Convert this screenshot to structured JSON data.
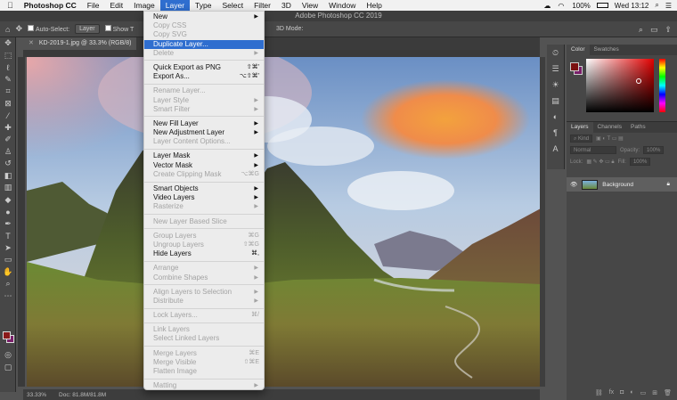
{
  "menubar": {
    "items": [
      {
        "label": "Photoshop CC",
        "bold": true
      },
      {
        "label": "File"
      },
      {
        "label": "Edit"
      },
      {
        "label": "Image"
      },
      {
        "label": "Layer",
        "active": true
      },
      {
        "label": "Type"
      },
      {
        "label": "Select"
      },
      {
        "label": "Filter"
      },
      {
        "label": "3D"
      },
      {
        "label": "View"
      },
      {
        "label": "Window"
      },
      {
        "label": "Help"
      }
    ],
    "battery": "100%",
    "clock": "Wed 13:12"
  },
  "window": {
    "title": "Adobe Photoshop CC 2019"
  },
  "options_bar": {
    "auto_select_label": "Auto-Select:",
    "auto_select_value": "Layer",
    "show_transform": "Show T",
    "three_d_mode": "3D Mode:"
  },
  "document": {
    "tab_label": "KD-2019-1.jpg @ 33.3% (RGB/8)",
    "zoom": "33.33%",
    "doc_size": "Doc: 81.8M/81.8M"
  },
  "panels": {
    "color_tabs": [
      "Color",
      "Swatches"
    ],
    "layer_tabs": [
      "Layers",
      "Channels",
      "Paths"
    ],
    "kind_label": "Kind",
    "blend_mode": "Normal",
    "opacity_label": "Opacity:",
    "opacity_value": "100%",
    "lock_label": "Lock:",
    "fill_label": "Fill:",
    "fill_value": "100%",
    "layers": [
      {
        "name": "Background"
      }
    ],
    "colors": {
      "foreground": "#7a1010",
      "background": "#7a1f6a"
    }
  },
  "layer_menu": {
    "sections": [
      [
        {
          "label": "New",
          "submenu": true
        },
        {
          "label": "Copy CSS",
          "disabled": true
        },
        {
          "label": "Copy SVG",
          "disabled": true
        },
        {
          "label": "Duplicate Layer...",
          "highlighted": true
        },
        {
          "label": "Delete",
          "disabled": true,
          "submenu": true
        }
      ],
      [
        {
          "label": "Quick Export as PNG",
          "shortcut": "⇧⌘'"
        },
        {
          "label": "Export As...",
          "shortcut": "⌥⇧⌘'"
        }
      ],
      [
        {
          "label": "Rename Layer...",
          "disabled": true
        },
        {
          "label": "Layer Style",
          "disabled": true,
          "submenu": true
        },
        {
          "label": "Smart Filter",
          "disabled": true,
          "submenu": true
        }
      ],
      [
        {
          "label": "New Fill Layer",
          "submenu": true
        },
        {
          "label": "New Adjustment Layer",
          "submenu": true
        },
        {
          "label": "Layer Content Options...",
          "disabled": true
        }
      ],
      [
        {
          "label": "Layer Mask",
          "submenu": true
        },
        {
          "label": "Vector Mask",
          "submenu": true
        },
        {
          "label": "Create Clipping Mask",
          "disabled": true,
          "shortcut": "⌥⌘G"
        }
      ],
      [
        {
          "label": "Smart Objects",
          "submenu": true
        },
        {
          "label": "Video Layers",
          "submenu": true
        },
        {
          "label": "Rasterize",
          "disabled": true,
          "submenu": true
        }
      ],
      [
        {
          "label": "New Layer Based Slice",
          "disabled": true
        }
      ],
      [
        {
          "label": "Group Layers",
          "disabled": true,
          "shortcut": "⌘G"
        },
        {
          "label": "Ungroup Layers",
          "disabled": true,
          "shortcut": "⇧⌘G"
        },
        {
          "label": "Hide Layers",
          "shortcut": "⌘,"
        }
      ],
      [
        {
          "label": "Arrange",
          "disabled": true,
          "submenu": true
        },
        {
          "label": "Combine Shapes",
          "disabled": true,
          "submenu": true
        }
      ],
      [
        {
          "label": "Align Layers to Selection",
          "disabled": true,
          "submenu": true
        },
        {
          "label": "Distribute",
          "disabled": true,
          "submenu": true
        }
      ],
      [
        {
          "label": "Lock Layers...",
          "disabled": true,
          "shortcut": "⌘/"
        }
      ],
      [
        {
          "label": "Link Layers",
          "disabled": true
        },
        {
          "label": "Select Linked Layers",
          "disabled": true
        }
      ],
      [
        {
          "label": "Merge Layers",
          "disabled": true,
          "shortcut": "⌘E"
        },
        {
          "label": "Merge Visible",
          "disabled": true,
          "shortcut": "⇧⌘E"
        },
        {
          "label": "Flatten Image",
          "disabled": true
        }
      ],
      [
        {
          "label": "Matting",
          "disabled": true,
          "submenu": true
        }
      ]
    ]
  }
}
